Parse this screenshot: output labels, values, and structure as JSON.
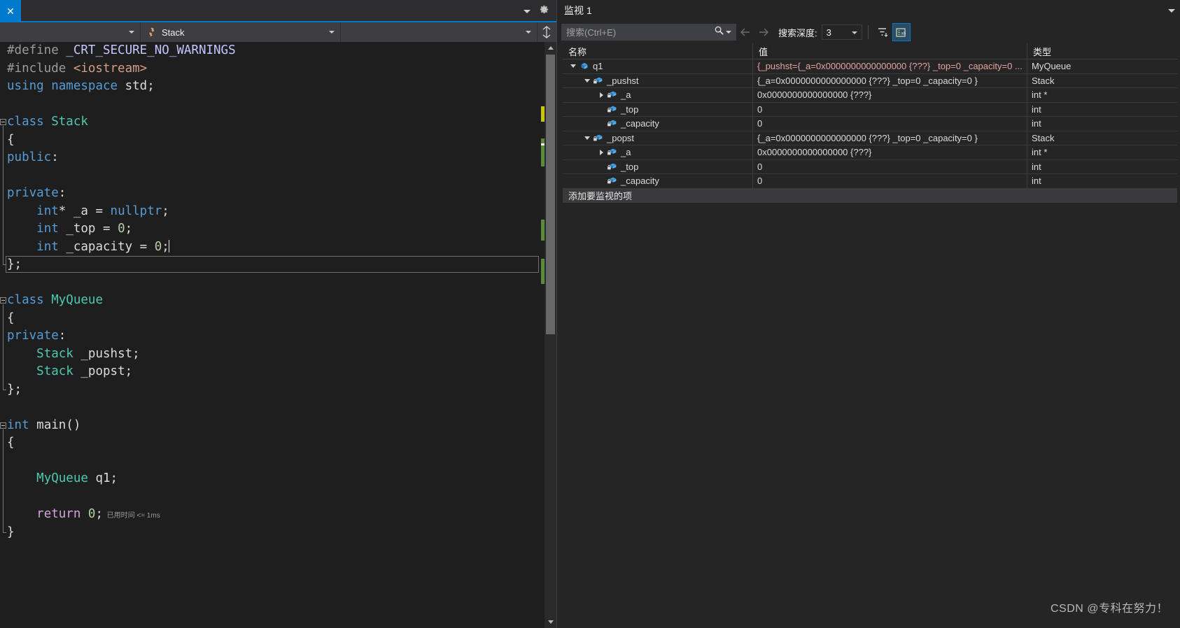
{
  "editor": {
    "tab": {
      "close_glyph": "✕"
    },
    "nav": {
      "scope_combo": "",
      "class_combo": "Stack",
      "member_combo": ""
    },
    "code_lines": [
      {
        "tokens": [
          {
            "t": "#define ",
            "c": "pd"
          },
          {
            "t": "_CRT_SECURE_NO_WARNINGS",
            "c": "p"
          }
        ]
      },
      {
        "tokens": [
          {
            "t": "#include ",
            "c": "pd"
          },
          {
            "t": "<iostream>",
            "c": "s"
          }
        ]
      },
      {
        "tokens": [
          {
            "t": "using",
            "c": "k"
          },
          {
            "t": " ",
            "c": "id"
          },
          {
            "t": "namespace",
            "c": "k"
          },
          {
            "t": " ",
            "c": "id"
          },
          {
            "t": "std",
            "c": "id"
          },
          {
            "t": ";",
            "c": "op"
          }
        ]
      },
      {
        "tokens": []
      },
      {
        "tokens": [
          {
            "t": "class",
            "c": "k"
          },
          {
            "t": " ",
            "c": "id"
          },
          {
            "t": "Stack",
            "c": "t"
          }
        ]
      },
      {
        "tokens": [
          {
            "t": "{",
            "c": "op"
          }
        ]
      },
      {
        "tokens": [
          {
            "t": "public",
            "c": "k"
          },
          {
            "t": ":",
            "c": "op"
          }
        ]
      },
      {
        "tokens": []
      },
      {
        "tokens": [
          {
            "t": "private",
            "c": "k"
          },
          {
            "t": ":",
            "c": "op"
          }
        ]
      },
      {
        "tokens": [
          {
            "t": "    ",
            "c": "id"
          },
          {
            "t": "int",
            "c": "k"
          },
          {
            "t": "* ",
            "c": "op"
          },
          {
            "t": "_a",
            "c": "id"
          },
          {
            "t": " = ",
            "c": "op"
          },
          {
            "t": "nullptr",
            "c": "k"
          },
          {
            "t": ";",
            "c": "op"
          }
        ]
      },
      {
        "tokens": [
          {
            "t": "    ",
            "c": "id"
          },
          {
            "t": "int",
            "c": "k"
          },
          {
            "t": " ",
            "c": "id"
          },
          {
            "t": "_top",
            "c": "id"
          },
          {
            "t": " = ",
            "c": "op"
          },
          {
            "t": "0",
            "c": "n"
          },
          {
            "t": ";",
            "c": "op"
          }
        ]
      },
      {
        "tokens": [
          {
            "t": "    ",
            "c": "id"
          },
          {
            "t": "int",
            "c": "k"
          },
          {
            "t": " ",
            "c": "id"
          },
          {
            "t": "_capacity",
            "c": "id"
          },
          {
            "t": " = ",
            "c": "op"
          },
          {
            "t": "0",
            "c": "n"
          },
          {
            "t": ";",
            "c": "op"
          }
        ]
      },
      {
        "tokens": [
          {
            "t": "};",
            "c": "op"
          }
        ]
      },
      {
        "tokens": []
      },
      {
        "tokens": [
          {
            "t": "class",
            "c": "k"
          },
          {
            "t": " ",
            "c": "id"
          },
          {
            "t": "MyQueue",
            "c": "t"
          }
        ]
      },
      {
        "tokens": [
          {
            "t": "{",
            "c": "op"
          }
        ]
      },
      {
        "tokens": [
          {
            "t": "private",
            "c": "k"
          },
          {
            "t": ":",
            "c": "op"
          }
        ]
      },
      {
        "tokens": [
          {
            "t": "    ",
            "c": "id"
          },
          {
            "t": "Stack",
            "c": "t"
          },
          {
            "t": " ",
            "c": "id"
          },
          {
            "t": "_pushst",
            "c": "id"
          },
          {
            "t": ";",
            "c": "op"
          }
        ]
      },
      {
        "tokens": [
          {
            "t": "    ",
            "c": "id"
          },
          {
            "t": "Stack",
            "c": "t"
          },
          {
            "t": " ",
            "c": "id"
          },
          {
            "t": "_popst",
            "c": "id"
          },
          {
            "t": ";",
            "c": "op"
          }
        ]
      },
      {
        "tokens": [
          {
            "t": "};",
            "c": "op"
          }
        ]
      },
      {
        "tokens": []
      },
      {
        "tokens": [
          {
            "t": "int",
            "c": "k"
          },
          {
            "t": " ",
            "c": "id"
          },
          {
            "t": "main",
            "c": "id"
          },
          {
            "t": "()",
            "c": "op"
          }
        ]
      },
      {
        "tokens": [
          {
            "t": "{",
            "c": "op"
          }
        ]
      },
      {
        "tokens": []
      },
      {
        "tokens": [
          {
            "t": "    ",
            "c": "id"
          },
          {
            "t": "MyQueue",
            "c": "t"
          },
          {
            "t": " ",
            "c": "id"
          },
          {
            "t": "q1",
            "c": "id"
          },
          {
            "t": ";",
            "c": "op"
          }
        ]
      },
      {
        "tokens": []
      },
      {
        "tokens": [
          {
            "t": "    ",
            "c": "id"
          },
          {
            "t": "return",
            "c": "ctl"
          },
          {
            "t": " ",
            "c": "id"
          },
          {
            "t": "0",
            "c": "n"
          },
          {
            "t": ";",
            "c": "op"
          }
        ]
      },
      {
        "tokens": [
          {
            "t": "}",
            "c": "op"
          }
        ]
      }
    ],
    "elapsed_annotation": "已用时间 <= 1ms"
  },
  "watch": {
    "title": "监视",
    "title_number": "1",
    "search": {
      "placeholder": "搜索(Ctrl+E)",
      "value": ""
    },
    "depth_label": "搜索深度:",
    "depth_value": "3",
    "columns": {
      "name": "名称",
      "value": "值",
      "type": "类型"
    },
    "rows": [
      {
        "indent": 0,
        "twisty": "open",
        "icon": "object-icon",
        "name": "q1",
        "value": "{_pushst={_a=0x0000000000000000 {???} _top=0 _capacity=0 ...",
        "value_changed": true,
        "type": "MyQueue"
      },
      {
        "indent": 1,
        "twisty": "open",
        "icon": "field-icon",
        "name": "_pushst",
        "value": "{_a=0x0000000000000000 {???} _top=0 _capacity=0 }",
        "value_changed": false,
        "type": "Stack"
      },
      {
        "indent": 2,
        "twisty": "closed",
        "icon": "field-icon",
        "name": "_a",
        "value": "0x0000000000000000 {???}",
        "value_changed": false,
        "type": "int *"
      },
      {
        "indent": 2,
        "twisty": "none",
        "icon": "field-icon",
        "name": "_top",
        "value": "0",
        "value_changed": false,
        "type": "int"
      },
      {
        "indent": 2,
        "twisty": "none",
        "icon": "field-icon",
        "name": "_capacity",
        "value": "0",
        "value_changed": false,
        "type": "int"
      },
      {
        "indent": 1,
        "twisty": "open",
        "icon": "field-icon",
        "name": "_popst",
        "value": "{_a=0x0000000000000000 {???} _top=0 _capacity=0 }",
        "value_changed": false,
        "type": "Stack"
      },
      {
        "indent": 2,
        "twisty": "closed",
        "icon": "field-icon",
        "name": "_a",
        "value": "0x0000000000000000 {???}",
        "value_changed": false,
        "type": "int *"
      },
      {
        "indent": 2,
        "twisty": "none",
        "icon": "field-icon",
        "name": "_top",
        "value": "0",
        "value_changed": false,
        "type": "int"
      },
      {
        "indent": 2,
        "twisty": "none",
        "icon": "field-icon",
        "name": "_capacity",
        "value": "0",
        "value_changed": false,
        "type": "int"
      }
    ],
    "add_watch_placeholder": "添加要监视的项"
  },
  "watermark": "CSDN @专科在努力！",
  "colors": {
    "accent": "#007acc",
    "editor_bg": "#1e1e1e",
    "panel_bg": "#252526",
    "toolbar_bg": "#3e3e42",
    "changed_value": "#e5a3a3"
  }
}
